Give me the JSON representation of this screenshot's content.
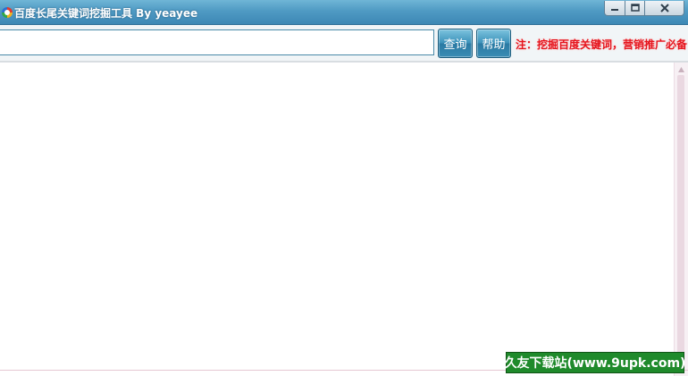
{
  "window": {
    "title": "百度长尾关键词挖掘工具 By yeayee",
    "icons": {
      "app": "app-logo-icon",
      "minimize": "minimize-icon",
      "maximize": "maximize-icon",
      "close": "close-icon"
    }
  },
  "toolbar": {
    "query_input": {
      "value": "",
      "placeholder": ""
    },
    "query_button_label": "查询",
    "help_button_label": "帮助",
    "notice": "注：挖掘百度关键词，营销推广必备!"
  },
  "results": {
    "text": ""
  },
  "watermark": {
    "text": "久友下载站(www.9upk.com)"
  },
  "colors": {
    "titlebar": "#4f9ac3",
    "button": "#3e93bb",
    "notice": "#e5141d",
    "watermark_bg": "#1f8a2b"
  }
}
